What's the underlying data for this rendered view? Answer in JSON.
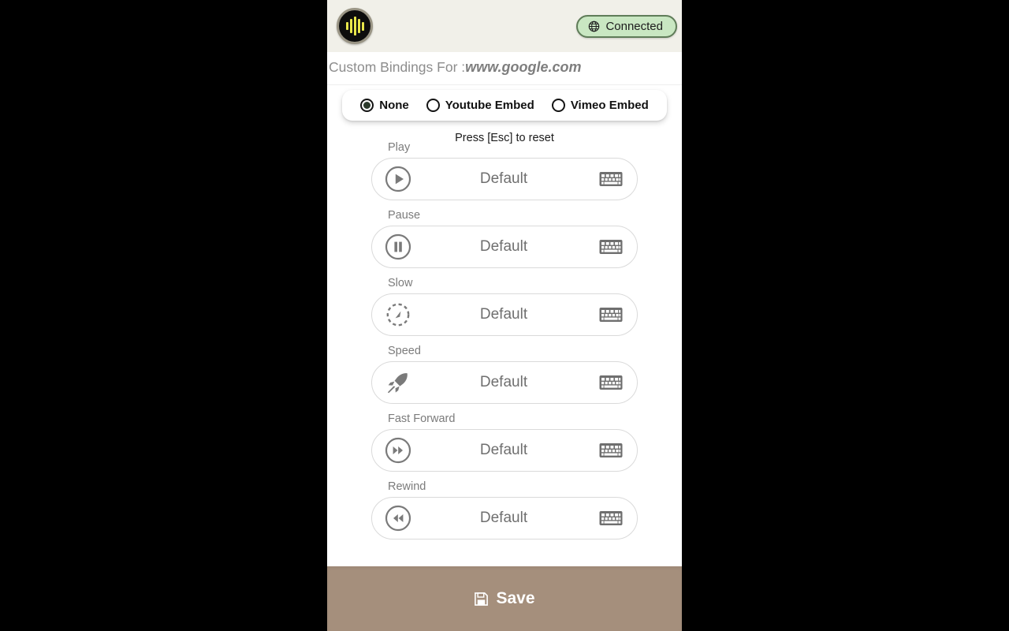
{
  "header": {
    "logo_name": "waveform-logo",
    "status": {
      "label": "Connected",
      "icon": "globe-icon",
      "fill": "#c9e7c2",
      "border": "#5f7c58"
    }
  },
  "site": {
    "prefix": "Custom Bindings For :",
    "domain": "www.google.com"
  },
  "modes": {
    "options": [
      {
        "label": "None",
        "selected": true
      },
      {
        "label": "Youtube Embed",
        "selected": false
      },
      {
        "label": "Vimeo Embed",
        "selected": false
      }
    ]
  },
  "hint": "Press [Esc] to reset",
  "bindings": [
    {
      "label": "Play",
      "value": "Default",
      "icon": "play-circle-icon"
    },
    {
      "label": "Pause",
      "value": "Default",
      "icon": "pause-circle-icon"
    },
    {
      "label": "Slow",
      "value": "Default",
      "icon": "slow-motion-icon"
    },
    {
      "label": "Speed",
      "value": "Default",
      "icon": "rocket-icon"
    },
    {
      "label": "Fast Forward",
      "value": "Default",
      "icon": "fast-forward-circle-icon"
    },
    {
      "label": "Rewind",
      "value": "Default",
      "icon": "rewind-circle-icon"
    }
  ],
  "keyboard_icon": "keyboard-icon",
  "footer": {
    "save_label": "Save",
    "save_icon": "floppy-disk-icon",
    "bg": "#a58f7c"
  }
}
